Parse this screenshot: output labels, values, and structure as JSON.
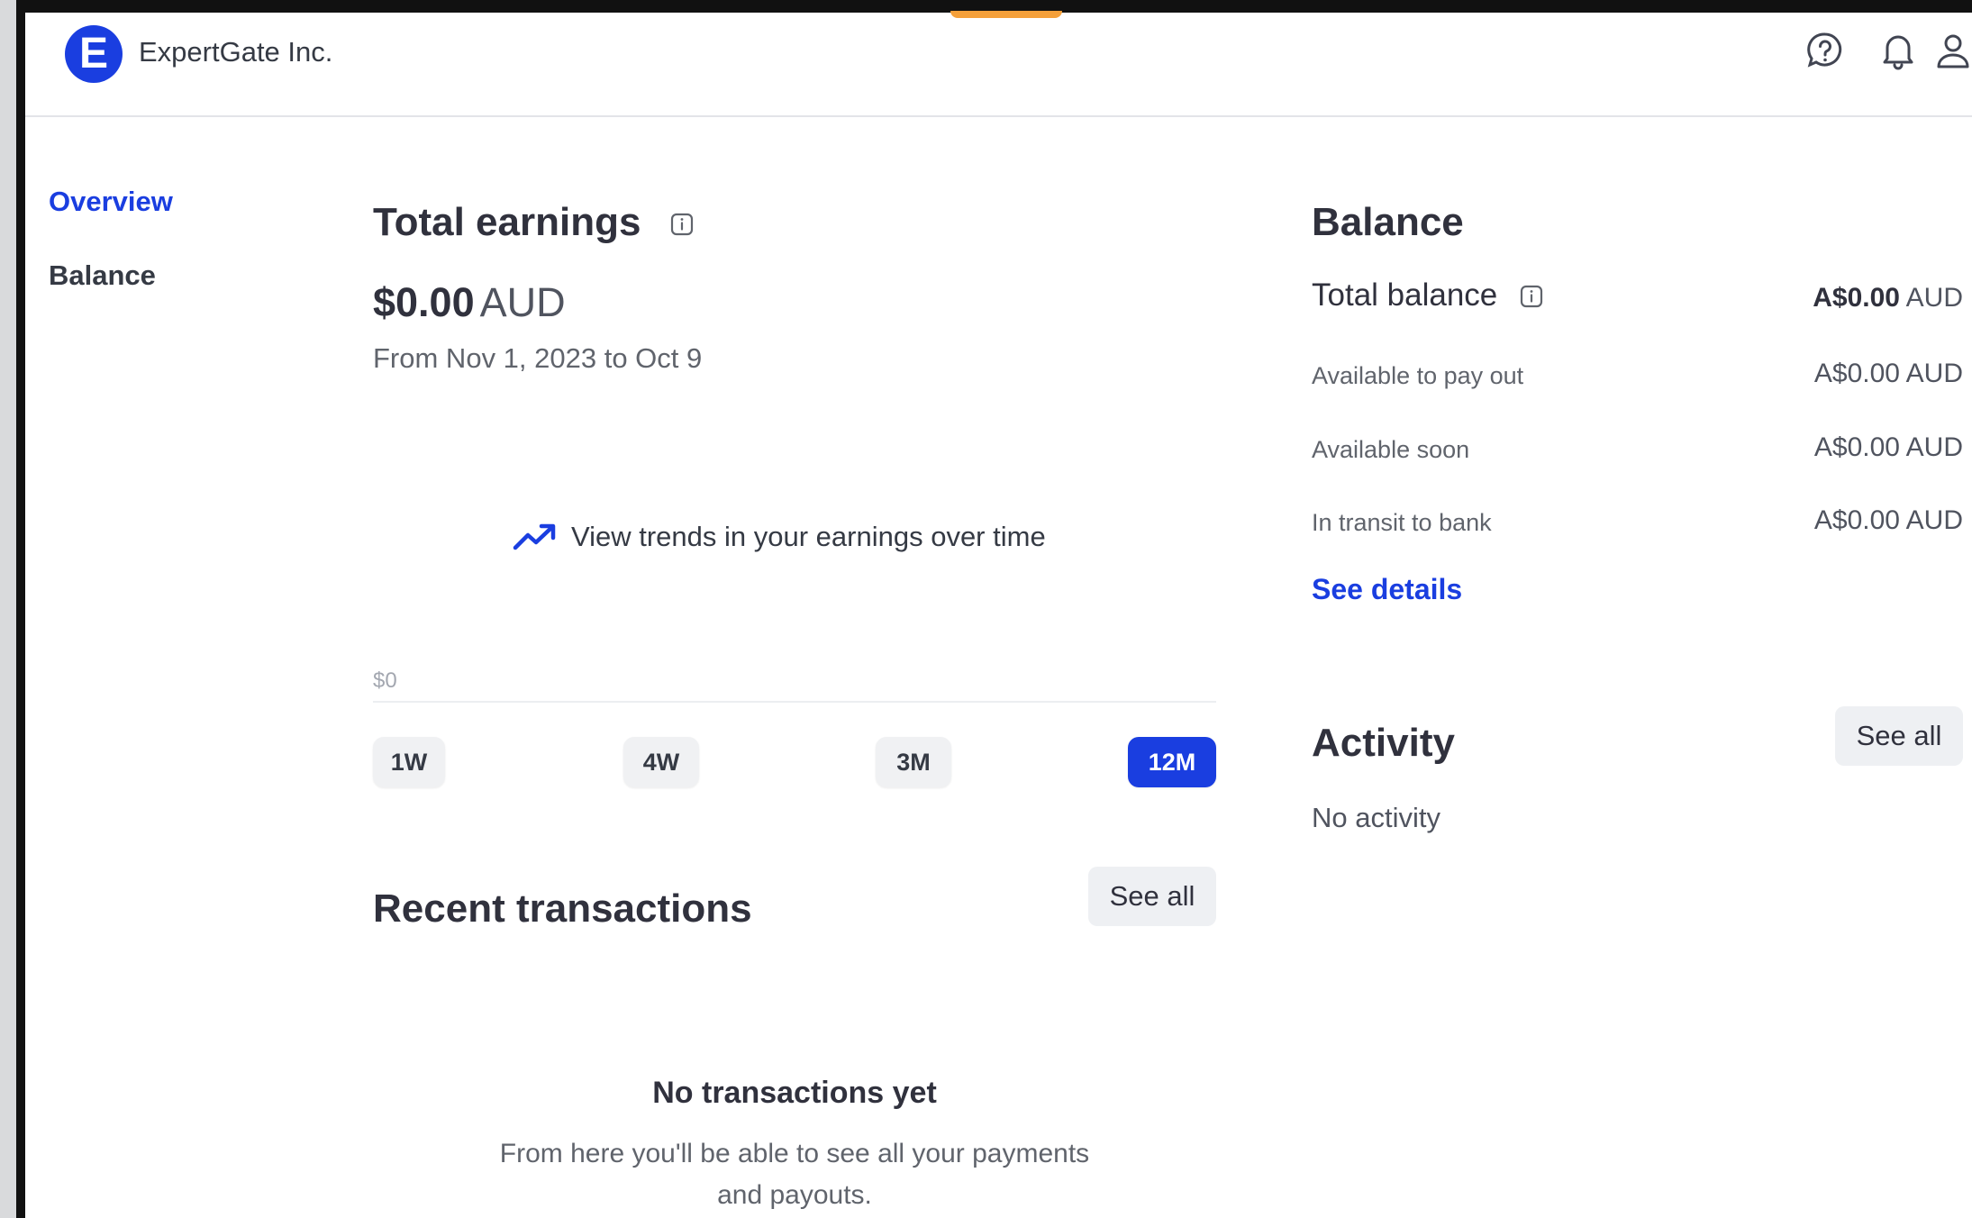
{
  "header": {
    "logo_letter": "E",
    "company_name": "ExpertGate Inc.",
    "icons": [
      "help-icon",
      "bell-icon",
      "user-icon"
    ]
  },
  "sidebar": {
    "items": [
      {
        "label": "Overview",
        "active": true
      },
      {
        "label": "Balance",
        "active": false
      }
    ]
  },
  "earnings": {
    "title": "Total earnings",
    "amount": "$0.00",
    "currency": "AUD",
    "date_range": "From Nov 1, 2023 to Oct 9",
    "trend_message": "View trends in your earnings over time",
    "axis_label": "$0",
    "ranges": [
      {
        "label": "1W",
        "active": false
      },
      {
        "label": "4W",
        "active": false
      },
      {
        "label": "3M",
        "active": false
      },
      {
        "label": "12M",
        "active": true
      }
    ]
  },
  "transactions": {
    "title": "Recent transactions",
    "see_all": "See all",
    "empty_title": "No transactions yet",
    "empty_line1": "From here you'll be able to see all your payments",
    "empty_line2": "and payouts."
  },
  "balance": {
    "title": "Balance",
    "total_label": "Total balance",
    "total_value": "A$0.00",
    "total_currency": "AUD",
    "rows": [
      {
        "label": "Available to pay out",
        "value": "A$0.00",
        "currency": "AUD"
      },
      {
        "label": "Available soon",
        "value": "A$0.00",
        "currency": "AUD"
      },
      {
        "label": "In transit to bank",
        "value": "A$0.00",
        "currency": "AUD"
      }
    ],
    "details_link": "See details"
  },
  "activity": {
    "title": "Activity",
    "see_all": "See all",
    "empty": "No activity"
  },
  "colors": {
    "accent": "#1a3ee0",
    "text": "#30313d",
    "muted": "#60646c",
    "button_bg": "#eef0f3"
  }
}
